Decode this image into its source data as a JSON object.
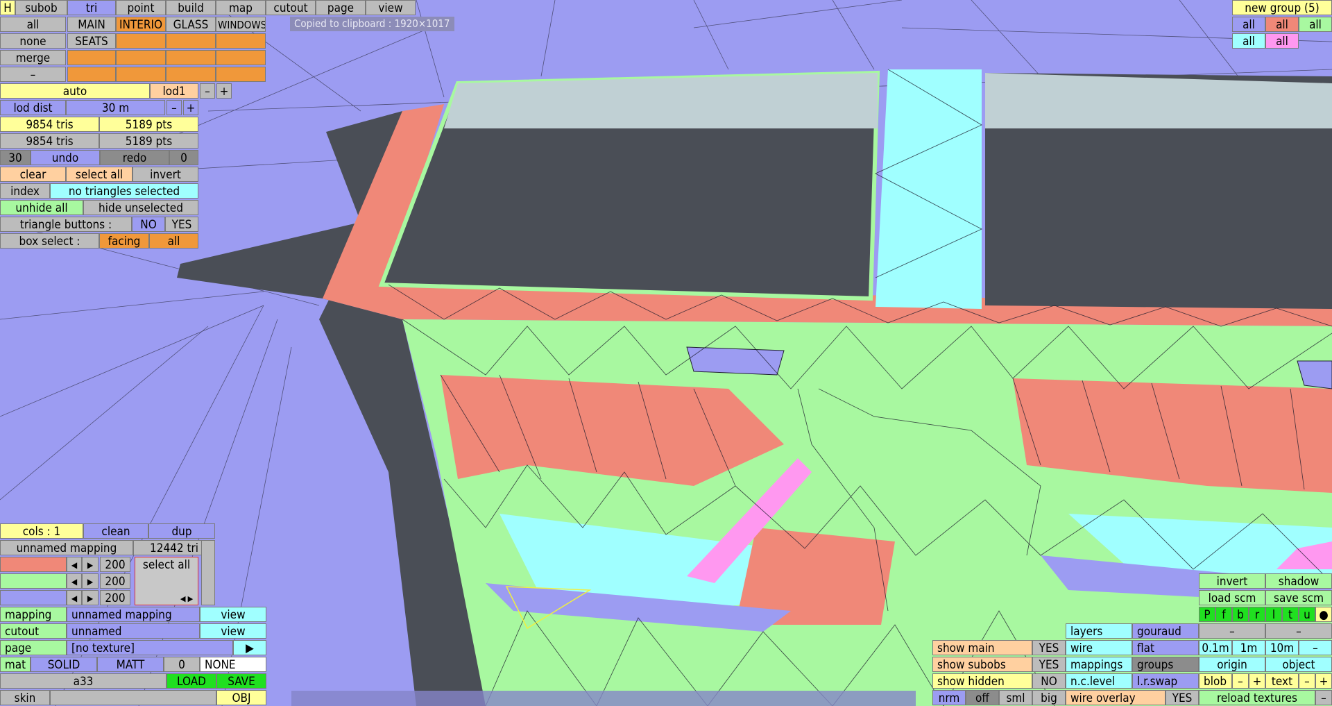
{
  "colors": {
    "blue": "#9c9cf2",
    "green": "#a8f8a0",
    "salmon": "#f08878",
    "cyan": "#a0ffff",
    "pink": "#ff98f0",
    "glass": "#4a4e56",
    "orange": "#f0983a",
    "yellow": "#ffff9a"
  },
  "menu": {
    "h": "H",
    "items": [
      "subob",
      "tri",
      "point",
      "build",
      "map",
      "cutout",
      "page",
      "view"
    ]
  },
  "groups": {
    "row1": [
      "all",
      "MAIN",
      "INTERIO",
      "GLASS",
      "WINDOWS"
    ],
    "none": "none",
    "seats": "SEATS",
    "merge": "merge",
    "minus": "–"
  },
  "toast": "Copied to clipboard : 1920×1017",
  "lod": {
    "auto": "auto",
    "name": "lod1",
    "minus": "–",
    "plus": "+",
    "dist_label": "lod dist",
    "dist_value": "30 m"
  },
  "stats": {
    "tris1": "9854 tris",
    "pts1": "5189 pts",
    "tris2": "9854 tris",
    "pts2": "5189 pts"
  },
  "history": {
    "count": "30",
    "undo": "undo",
    "redo": "redo",
    "zero": "0"
  },
  "selection": {
    "clear": "clear",
    "select_all": "select all",
    "invert": "invert",
    "index": "index",
    "status": "no triangles selected",
    "unhide_all": "unhide all",
    "hide_unselected": "hide unselected"
  },
  "tri_buttons": {
    "label": "triangle buttons :",
    "no": "NO",
    "yes": "YES"
  },
  "box_select": {
    "label": "box select :",
    "facing": "facing",
    "all": "all"
  },
  "newgroup": {
    "title": "new group (5)",
    "all": "all"
  },
  "mapping": {
    "cols": "cols : 1",
    "clean": "clean",
    "dup": "dup",
    "name": "unnamed mapping",
    "tri_count": "12442 tri",
    "values": [
      "200",
      "200",
      "200"
    ],
    "select_all": "select all"
  },
  "props": {
    "mapping_label": "mapping",
    "mapping_value": "unnamed mapping",
    "view": "view",
    "cutout_label": "cutout",
    "cutout_value": "unnamed",
    "page_label": "page",
    "page_value": "[no texture]",
    "play": "▶",
    "mat": "mat",
    "solid": "SOLID",
    "matt": "MATT",
    "zero": "0",
    "none": "NONE",
    "matname": "a33",
    "load": "LOAD",
    "save": "SAVE",
    "skin": "skin",
    "obj": "OBJ"
  },
  "display": {
    "show_main": "show main",
    "show_subobs": "show subobs",
    "show_hidden": "show hidden",
    "yes": "YES",
    "no": "NO",
    "nrm": "nrm",
    "off": "off",
    "sml": "sml",
    "big": "big"
  },
  "render": {
    "layers": "layers",
    "gouraud": "gouraud",
    "wire": "wire",
    "flat": "flat",
    "mappings": "mappings",
    "groups": "groups",
    "nclevel": "n.c.level",
    "lrswap": "l.r.swap",
    "wire_overlay": "wire overlay",
    "yes": "YES"
  },
  "tools": {
    "invert": "invert",
    "shadow": "shadow",
    "load_scm": "load scm",
    "save_scm": "save scm",
    "views": [
      "P",
      "f",
      "b",
      "r",
      "l",
      "t",
      "u",
      "●"
    ],
    "dash": "–",
    "steps": [
      "0.1m",
      "1m",
      "10m",
      "–"
    ],
    "origin": "origin",
    "object": "object",
    "blob": "blob",
    "minus": "–",
    "plus": "+",
    "text": "text",
    "reload": "reload textures"
  }
}
